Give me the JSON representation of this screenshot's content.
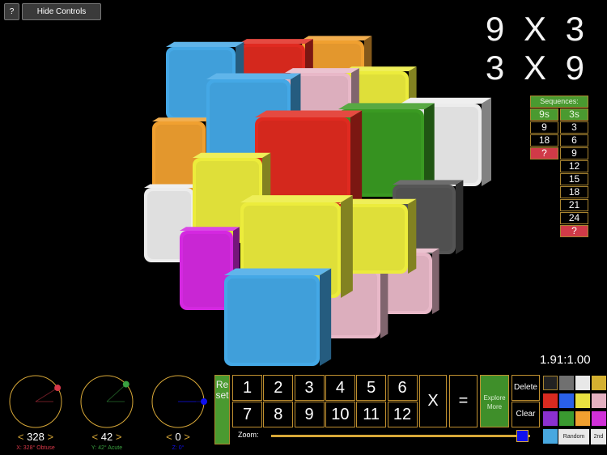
{
  "toolbar": {
    "help_label": "?",
    "hide_controls_label": "Hide Controls"
  },
  "equations": [
    "9 X 3",
    "3 X 9"
  ],
  "sequences": {
    "title": "Sequences:",
    "col1": {
      "header": "9s",
      "values": [
        "9",
        "18",
        "?"
      ]
    },
    "col2": {
      "header": "3s",
      "values": [
        "3",
        "6",
        "9",
        "12",
        "15",
        "18",
        "21",
        "24",
        "?"
      ]
    }
  },
  "ratio": "1.91:1.00",
  "dials": [
    {
      "axis": "x",
      "value": "328",
      "caption": "X: 328° Obtuse",
      "color": "#d83848",
      "angle": 328
    },
    {
      "axis": "y",
      "value": "42",
      "caption": "Y: 42° Acute",
      "color": "#3aa040",
      "angle": 42
    },
    {
      "axis": "z",
      "value": "0",
      "caption": "Z: 0°",
      "color": "#1010ee",
      "angle": 0
    }
  ],
  "arrows": {
    "left": "<",
    "right": ">"
  },
  "reset_label": "Reset",
  "keypad": [
    "1",
    "2",
    "3",
    "4",
    "5",
    "6",
    "7",
    "8",
    "9",
    "10",
    "11",
    "12"
  ],
  "times_label": "X",
  "equals_label": "=",
  "explore_label": "Explore More",
  "delete_label": "Delete",
  "clear_label": "Clear",
  "zoom_label": "Zoom:",
  "zoom_value": 0.97,
  "palette": [
    "#222222",
    "#707070",
    "#e8e8e8",
    "#d4b030",
    "#d82a20",
    "#2a60e8",
    "#e8e040",
    "#e4b0c0",
    "#8a30d0",
    "#3a9a30",
    "#f0a030",
    "#d030d8",
    "#48a8e0"
  ],
  "random_label": "Random",
  "second_label": "2nd",
  "cube_colors": {
    "orange": "#f0a030",
    "red": "#e02a20",
    "blue": "#44a8e6",
    "yellow": "#ecec3c",
    "pink": "#e8b8c8",
    "white": "#ececec",
    "green": "#3a9a22",
    "gray": "#555555",
    "magenta": "#d428e0"
  }
}
